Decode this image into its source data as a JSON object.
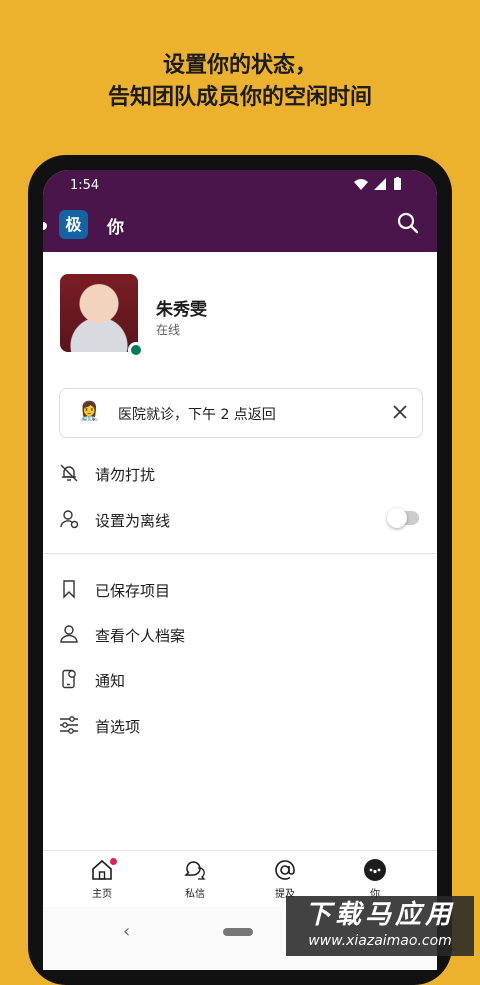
{
  "promo": {
    "line1": "设置你的状态，",
    "line2": "告知团队成员你的空闲时间"
  },
  "statusbar": {
    "time": "1:54",
    "icons": "▾◢▮"
  },
  "appbar": {
    "workspace": "极",
    "title": "你"
  },
  "profile": {
    "name": "朱秀雯",
    "presence": "在线"
  },
  "custom_status": {
    "emoji": "👩‍⚕️",
    "text": "医院就诊，下午 2 点返回"
  },
  "menu": {
    "dnd": "请勿打扰",
    "away": "设置为离线",
    "away_toggle_on": false,
    "saved": "已保存项目",
    "profile": "查看个人档案",
    "notifications": "通知",
    "preferences": "首选项"
  },
  "tabs": {
    "home": "主页",
    "dms": "私信",
    "mentions": "提及",
    "you": "你"
  },
  "nav": {
    "back": "‹"
  },
  "watermark": {
    "line1": "下载马应用",
    "line2": "www.xiazaimao.com"
  },
  "colors": {
    "background": "#ECB22E",
    "header": "#4A154B",
    "presence": "#007a5a",
    "badge": "#e01e5a"
  }
}
